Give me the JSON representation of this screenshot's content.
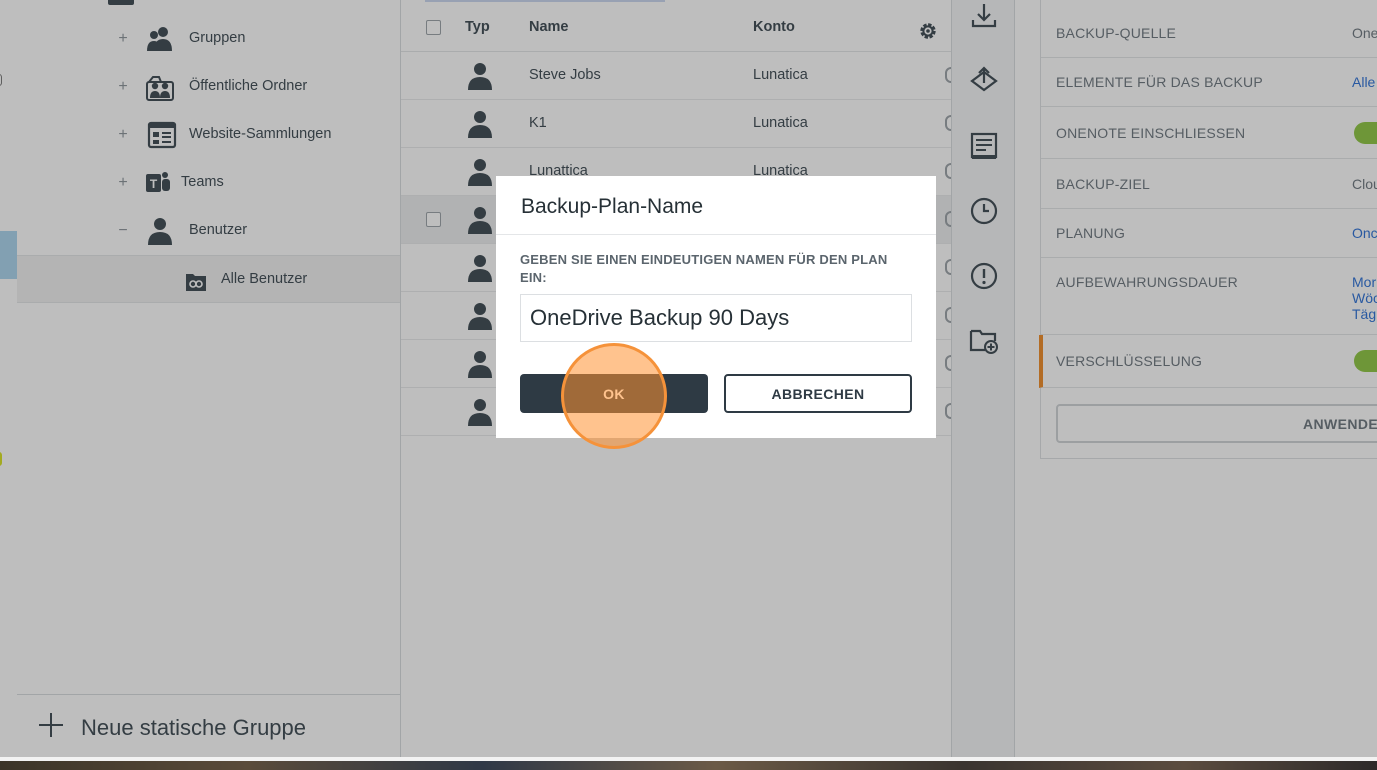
{
  "tree": {
    "nodes": [
      {
        "toggle": "+",
        "label": "Gruppen",
        "icon": "group-icon"
      },
      {
        "toggle": "+",
        "label": "Öffentliche Ordner",
        "icon": "public-folders-icon"
      },
      {
        "toggle": "+",
        "label": "Website-Sammlungen",
        "icon": "site-collections-icon"
      },
      {
        "toggle": "+",
        "label": "Teams",
        "icon": "teams-icon"
      },
      {
        "toggle": "−",
        "label": "Benutzer",
        "icon": "user-icon"
      },
      {
        "toggle": "",
        "label": "Alle Benutzer",
        "icon": "all-users-icon"
      }
    ],
    "new_group_label": "Neue statische Gruppe"
  },
  "table": {
    "columns": {
      "type": "Typ",
      "name": "Name",
      "account": "Konto"
    },
    "rows": [
      {
        "name": "Steve Jobs",
        "account": "Lunatica"
      },
      {
        "name": "K1",
        "account": "Lunatica"
      },
      {
        "name": "Lunattica",
        "account": "Lunatica"
      },
      {
        "name": "",
        "account": ""
      },
      {
        "name": "",
        "account": ""
      },
      {
        "name": "",
        "account": ""
      },
      {
        "name": "",
        "account": ""
      },
      {
        "name": "",
        "account": ""
      }
    ]
  },
  "toolbar": {
    "icons": [
      "download-icon",
      "restore-icon",
      "report-icon",
      "clock-icon",
      "alert-icon",
      "add-folder-icon"
    ]
  },
  "settings": {
    "rows": [
      {
        "key": "BACKUP-QUELLE",
        "value": "One"
      },
      {
        "key": "ELEMENTE FÜR DAS BACKUP",
        "value": "Alle"
      },
      {
        "key": "ONENOTE EINSCHLIESSEN",
        "toggle": true
      },
      {
        "key": "BACKUP-ZIEL",
        "value": "Clou"
      },
      {
        "key": "PLANUNG",
        "value": "Onc"
      },
      {
        "key": "AUFBEWAHRUNGSDAUER",
        "value_lines": [
          "Mor",
          "Wöc",
          "Tägl"
        ]
      },
      {
        "key": "VERSCHLÜSSELUNG",
        "toggle": true
      }
    ],
    "apply_label": "ANWENDEN"
  },
  "dialog": {
    "title": "Backup-Plan-Name",
    "prompt": "GEBEN SIE EINEN EINDEUTIGEN NAMEN FÜR DEN PLAN EIN:",
    "input_value": "OneDrive Backup 90 Days",
    "ok_label": "OK",
    "cancel_label": "ABBRECHEN"
  },
  "colors": {
    "accent_orange": "#f08a24",
    "toggle_green": "#8dc63f",
    "link_blue": "#2a6fd6",
    "dark_button": "#2e3a44"
  }
}
